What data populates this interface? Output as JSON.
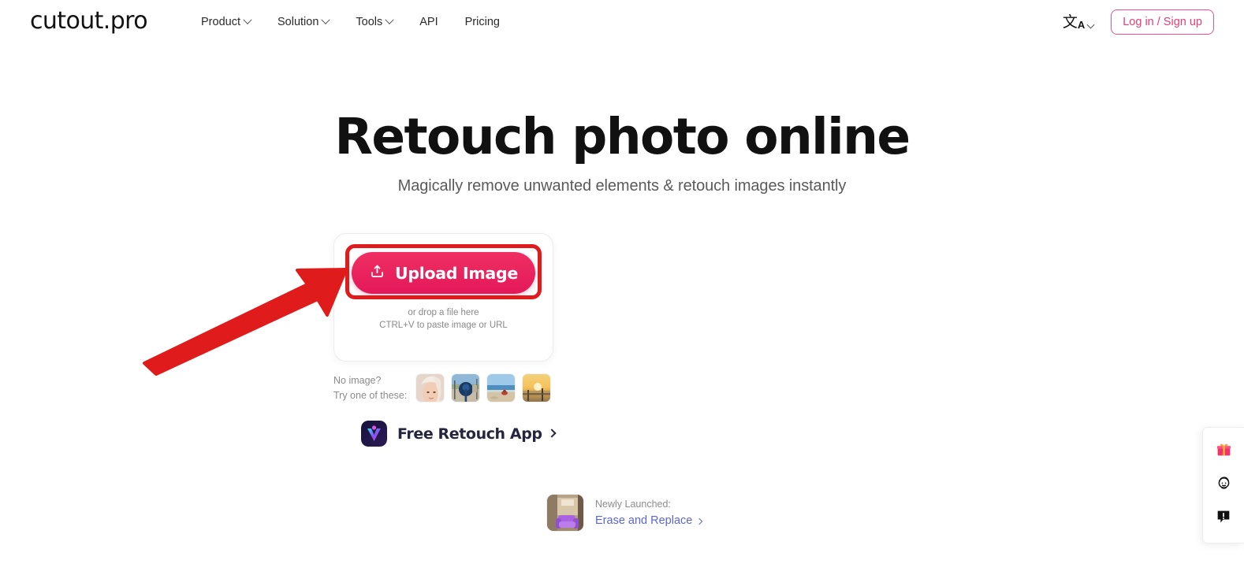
{
  "header": {
    "logo": "cutout.pro",
    "nav": [
      {
        "label": "Product",
        "has_chevron": true
      },
      {
        "label": "Solution",
        "has_chevron": true
      },
      {
        "label": "Tools",
        "has_chevron": true
      },
      {
        "label": "API",
        "has_chevron": false
      },
      {
        "label": "Pricing",
        "has_chevron": false
      }
    ],
    "language_glyph": "文",
    "language_sub": "A",
    "login_label": "Log in / Sign up",
    "accent_color": "#e83d73"
  },
  "hero": {
    "title": "Retouch photo online",
    "subtitle": "Magically remove unwanted elements & retouch images instantly"
  },
  "upload": {
    "button_label": "Upload Image",
    "button_icon": "upload-icon",
    "drop_line1": "or drop a file here",
    "drop_line2": "CTRL+V to paste image or URL",
    "button_color": "#e8185a",
    "annotation_color": "#e01b1b"
  },
  "samples": {
    "label_line1": "No image?",
    "label_line2": "Try one of these:",
    "thumbnails": [
      {
        "name": "sample-portrait-towel"
      },
      {
        "name": "sample-street-bicycle"
      },
      {
        "name": "sample-beach-sky"
      },
      {
        "name": "sample-sunset-pier"
      }
    ]
  },
  "app_promo": {
    "label": "Free Retouch App",
    "icon": "retouch-app-icon",
    "arrow": "chevron-right-icon"
  },
  "newly_launched": {
    "label": "Newly Launched:",
    "link_label": "Erase and Replace",
    "link_color": "#5b66d6",
    "thumbnail": "purple-armchair-room"
  },
  "side_widget": {
    "items": [
      {
        "name": "gift-icon",
        "label": "Gift"
      },
      {
        "name": "support-face-icon",
        "label": "Support"
      },
      {
        "name": "feedback-icon",
        "label": "Feedback"
      }
    ]
  }
}
